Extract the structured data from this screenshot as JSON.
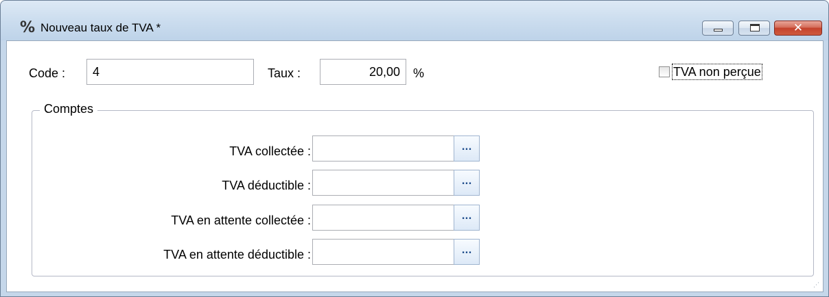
{
  "window": {
    "title": "Nouveau taux de TVA *",
    "title_icon": "percent-icon",
    "close_glyph": "✕"
  },
  "form": {
    "code_label": "Code :",
    "code_value": "4",
    "taux_label": "Taux :",
    "taux_value": "20,00",
    "taux_unit": "%",
    "tva_non_percue_label": "TVA non perçue",
    "tva_non_percue_checked": false
  },
  "comptes": {
    "group_title": "Comptes",
    "ellipsis": "...",
    "rows": [
      {
        "label": "TVA collectée :",
        "value": ""
      },
      {
        "label": "TVA déductible :",
        "value": ""
      },
      {
        "label": "TVA en attente collectée :",
        "value": ""
      },
      {
        "label": "TVA en attente déductible :",
        "value": ""
      }
    ]
  }
}
